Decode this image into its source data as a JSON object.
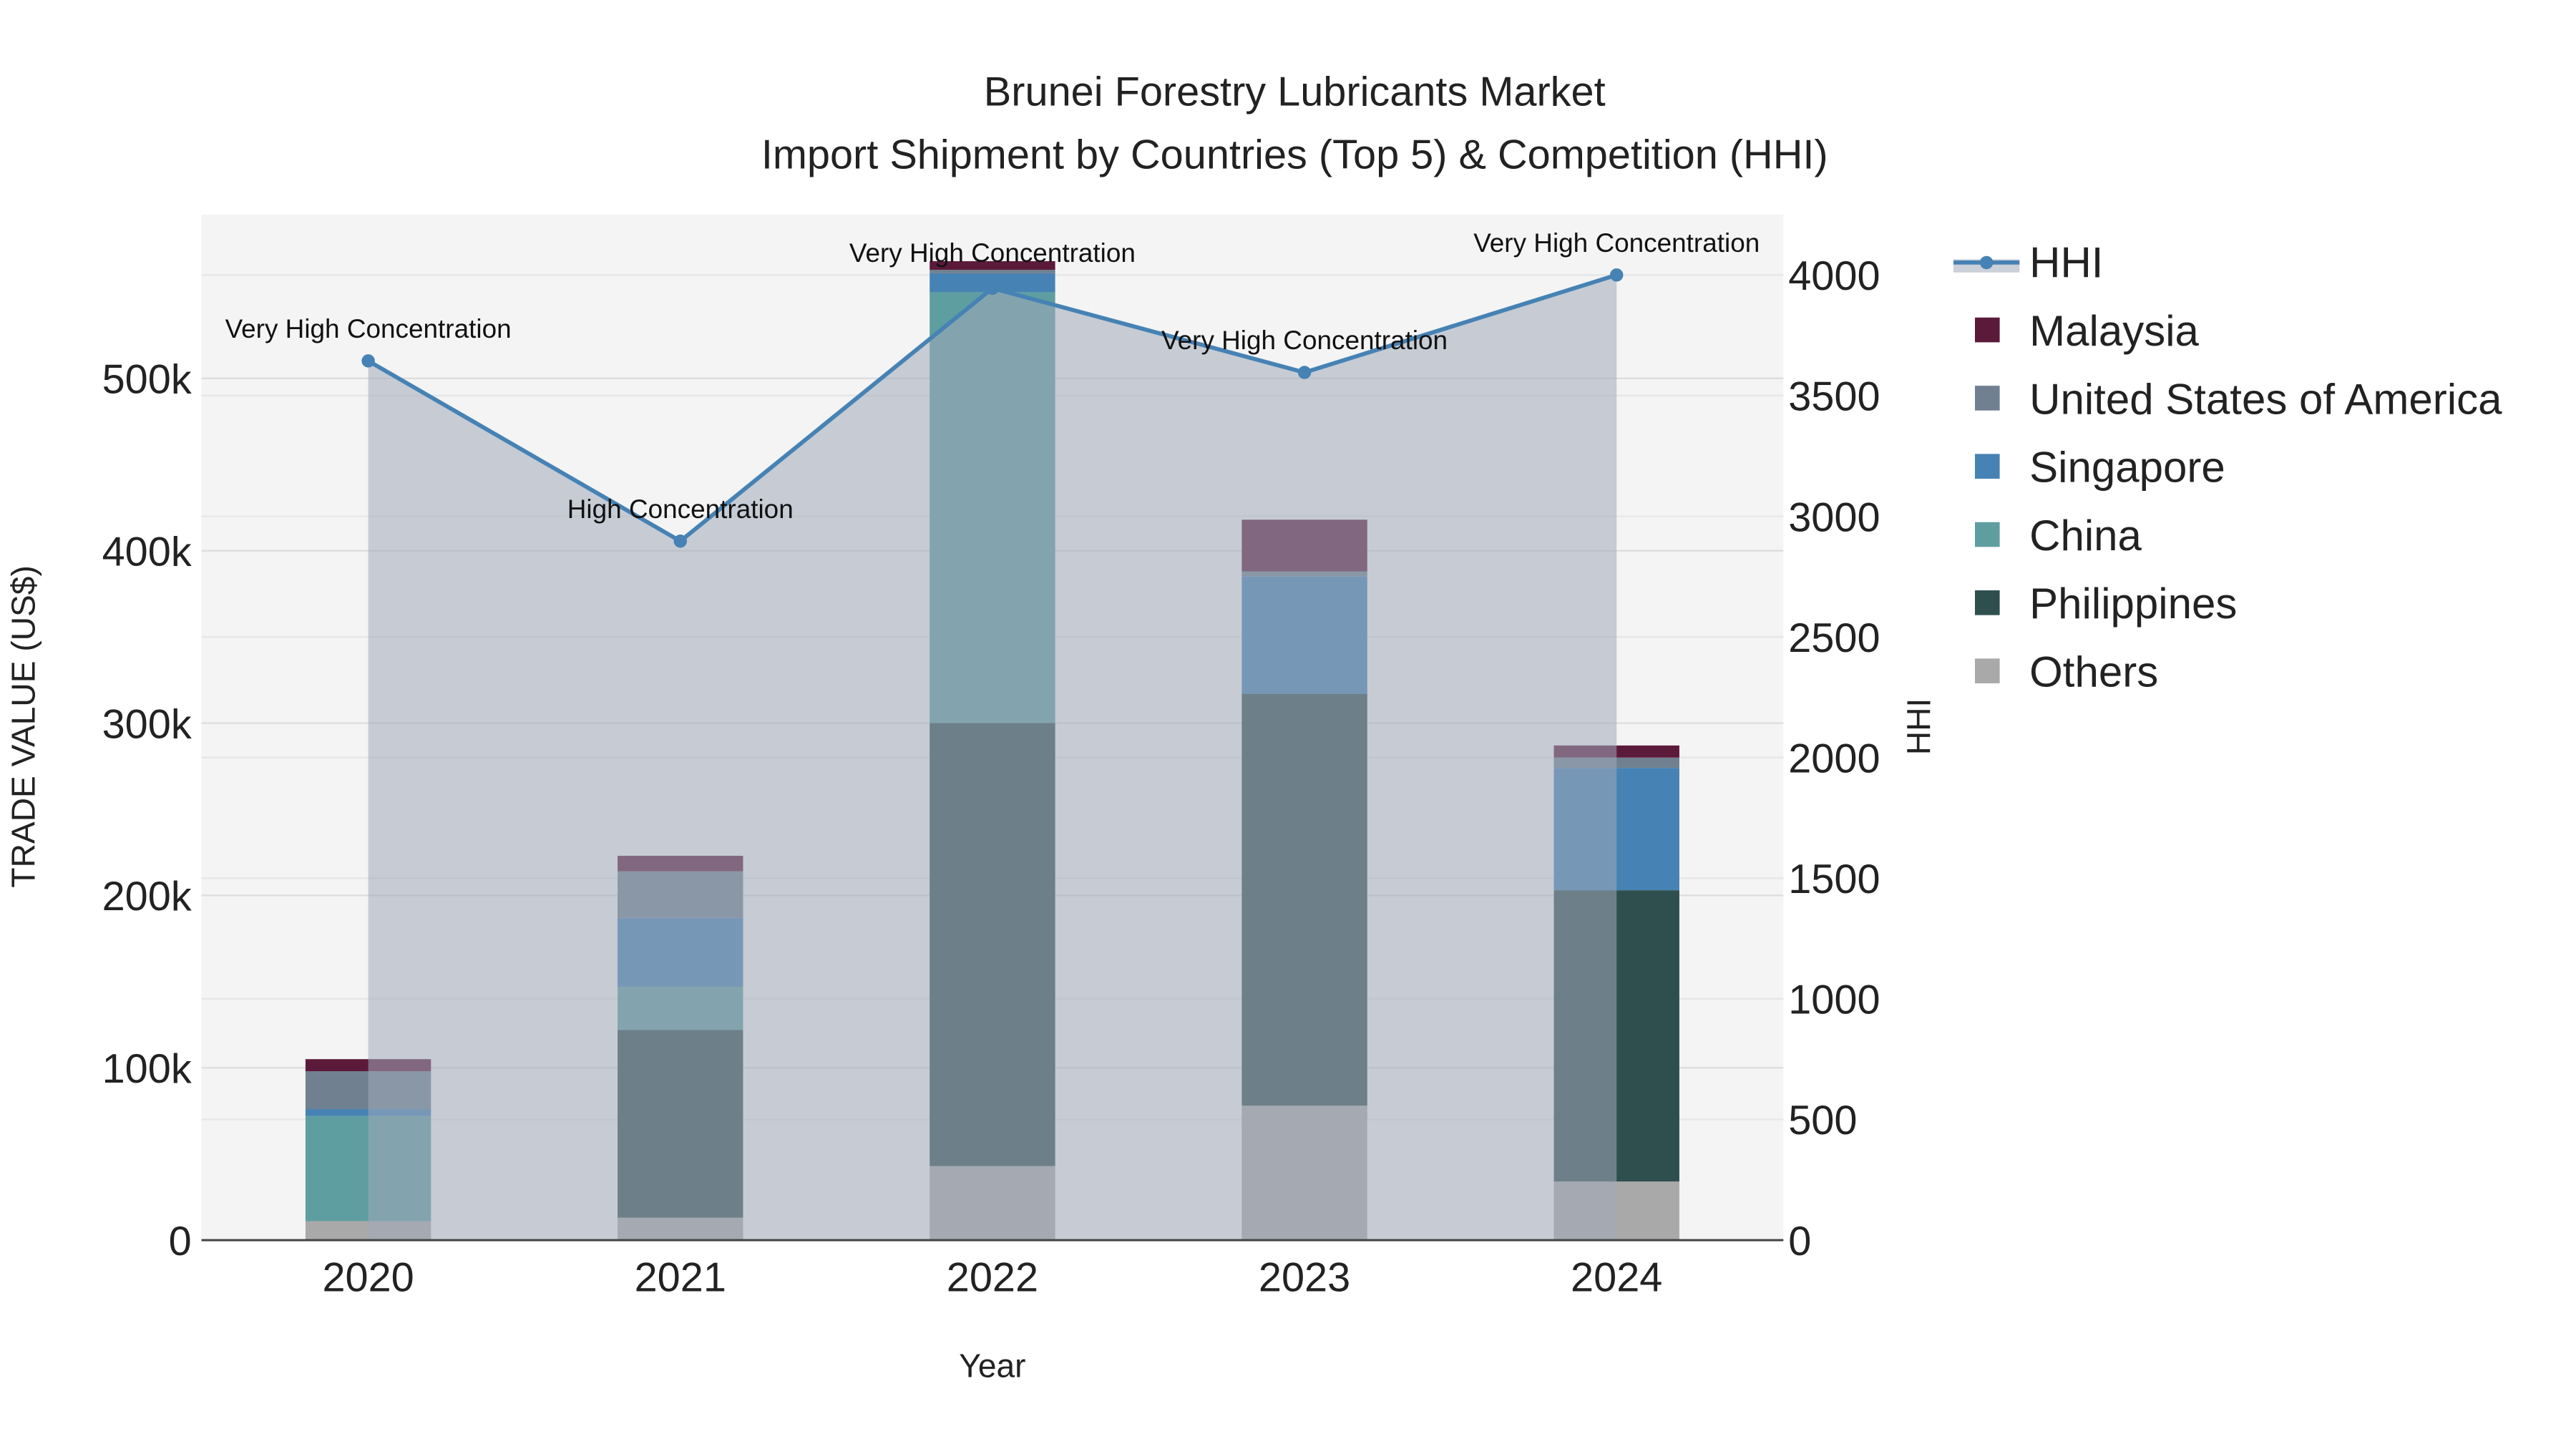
{
  "chart_data": {
    "type": "bar",
    "title": "Brunei Forestry Lubricants Market",
    "subtitle": "Import Shipment by Countries (Top 5) & Competition (HHI)",
    "xlabel": "Year",
    "ylabel": "TRADE VALUE (US$)",
    "y2label": "HHI",
    "categories": [
      "2020",
      "2021",
      "2022",
      "2023",
      "2024"
    ],
    "ylim": [
      0,
      595000
    ],
    "y2lim": [
      0,
      4250
    ],
    "yticks": [
      0,
      100000,
      200000,
      300000,
      400000,
      500000
    ],
    "ytick_labels": [
      "0",
      "100k",
      "200k",
      "300k",
      "400k",
      "500k"
    ],
    "y2ticks": [
      0,
      500,
      1000,
      1500,
      2000,
      2500,
      3000,
      3500,
      4000
    ],
    "y2tick_labels": [
      "0",
      "500",
      "1000",
      "1500",
      "2000",
      "2500",
      "3000",
      "3500",
      "4000"
    ],
    "grid": true,
    "legend_position": "right",
    "series": [
      {
        "name": "Others",
        "color": "#a9a9a9",
        "values": [
          11000,
          13000,
          43000,
          78000,
          34000
        ]
      },
      {
        "name": "Philippines",
        "color": "#2f4f4f",
        "values": [
          0,
          109000,
          257000,
          239000,
          169000
        ]
      },
      {
        "name": "China",
        "color": "#5f9ea0",
        "values": [
          61000,
          25000,
          250000,
          0,
          0
        ]
      },
      {
        "name": "Singapore",
        "color": "#4682b4",
        "values": [
          4000,
          40000,
          11000,
          68000,
          71000
        ]
      },
      {
        "name": "United States of America",
        "color": "#708090",
        "values": [
          22000,
          27000,
          2000,
          3000,
          6000
        ]
      },
      {
        "name": "Malaysia",
        "color": "#5c1a3a",
        "values": [
          7000,
          9000,
          5000,
          30000,
          7000
        ]
      }
    ],
    "hhi": {
      "name": "HHI",
      "color": "#4682b4",
      "values": [
        3644,
        2897,
        3945,
        3596,
        4000
      ],
      "labels": [
        "Very High Concentration",
        "High Concentration",
        "Very High Concentration",
        "Very High Concentration",
        "Very High Concentration"
      ]
    },
    "legend_order": [
      "HHI",
      "Malaysia",
      "United States of America",
      "Singapore",
      "China",
      "Philippines",
      "Others"
    ]
  }
}
